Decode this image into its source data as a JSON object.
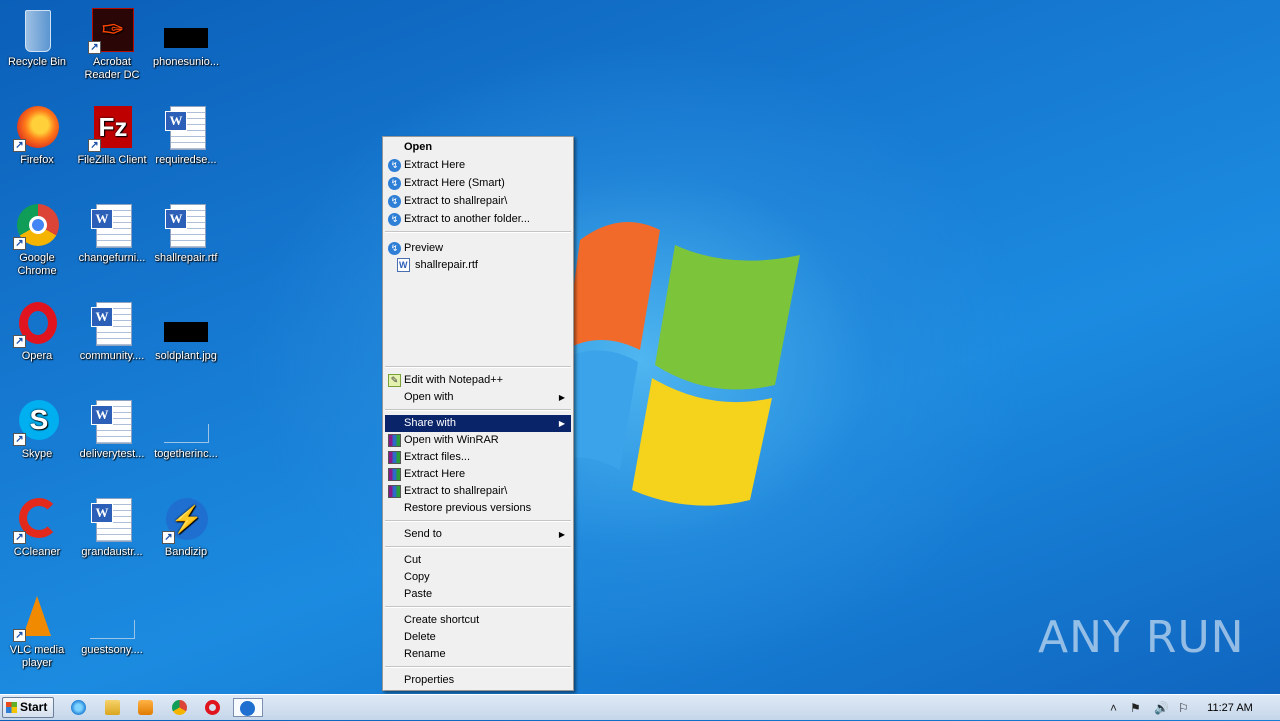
{
  "desktop": {
    "icons": [
      {
        "label": "Recycle Bin",
        "icon": "recycle-bin-icon"
      },
      {
        "label": "Acrobat Reader DC",
        "icon": "acrobat-icon"
      },
      {
        "label": "phonesunio...",
        "icon": "image-file-icon"
      },
      {
        "label": "Firefox",
        "icon": "firefox-icon"
      },
      {
        "label": "FileZilla Client",
        "icon": "filezilla-icon"
      },
      {
        "label": "requiredse...",
        "icon": "word-doc-icon"
      },
      {
        "label": "Google Chrome",
        "icon": "chrome-icon"
      },
      {
        "label": "changefurni...",
        "icon": "word-doc-icon"
      },
      {
        "label": "shallrepair.rtf",
        "icon": "word-doc-icon"
      },
      {
        "label": "Opera",
        "icon": "opera-icon"
      },
      {
        "label": "community....",
        "icon": "word-doc-icon"
      },
      {
        "label": "soldplant.jpg",
        "icon": "image-file-icon"
      },
      {
        "label": "Skype",
        "icon": "skype-icon"
      },
      {
        "label": "deliverytest...",
        "icon": "word-doc-icon"
      },
      {
        "label": "togetherinc...",
        "icon": "blank-file-icon"
      },
      {
        "label": "CCleaner",
        "icon": "ccleaner-icon"
      },
      {
        "label": "grandaustr...",
        "icon": "word-doc-icon"
      },
      {
        "label": "Bandizip",
        "icon": "bandizip-icon"
      },
      {
        "label": "VLC media player",
        "icon": "vlc-icon"
      },
      {
        "label": "guestsony....",
        "icon": "blank-file-icon"
      }
    ]
  },
  "context_menu": {
    "open": "Open",
    "extract_here": "Extract Here",
    "extract_here_smart": "Extract Here (Smart)",
    "extract_to": "Extract to shallrepair\\",
    "extract_to_other": "Extract to another folder...",
    "preview": "Preview",
    "preview_file": "shallrepair.rtf",
    "edit_notepadpp": "Edit with Notepad++",
    "open_with": "Open with",
    "share_with": "Share with",
    "open_with_winrar": "Open with WinRAR",
    "extract_files": "Extract files...",
    "rar_extract_here": "Extract Here",
    "rar_extract_to": "Extract to shallrepair\\",
    "restore_previous": "Restore previous versions",
    "send_to": "Send to",
    "cut": "Cut",
    "copy": "Copy",
    "paste": "Paste",
    "create_shortcut": "Create shortcut",
    "delete": "Delete",
    "rename": "Rename",
    "properties": "Properties"
  },
  "taskbar": {
    "start_label": "Start",
    "apps": [
      "internet-explorer-icon",
      "explorer-icon",
      "media-player-icon",
      "chrome-icon",
      "opera-icon",
      "bandizip-icon"
    ],
    "clock": "11:27 AM"
  },
  "watermark": "ANY RUN",
  "colors": {
    "highlight": "#0a246a",
    "menu_bg": "#f0f0f0"
  }
}
